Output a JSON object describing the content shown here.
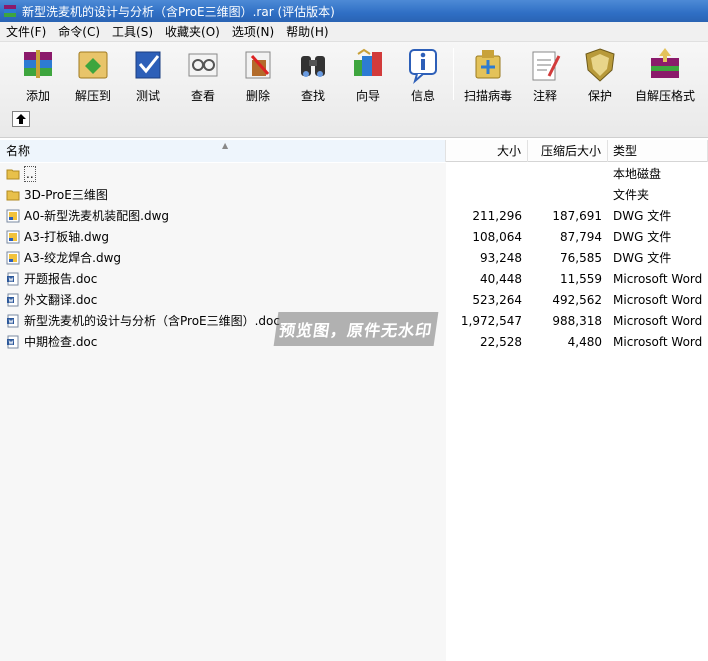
{
  "window": {
    "title": "新型洗麦机的设计与分析（含ProE三维图）.rar (评估版本)"
  },
  "menu": [
    "文件(F)",
    "命令(C)",
    "工具(S)",
    "收藏夹(O)",
    "选项(N)",
    "帮助(H)"
  ],
  "toolbar": {
    "buttons": [
      {
        "label": "添加",
        "icon": "add-archive-icon"
      },
      {
        "label": "解压到",
        "icon": "extract-to-icon"
      },
      {
        "label": "测试",
        "icon": "test-icon"
      },
      {
        "label": "查看",
        "icon": "view-icon"
      },
      {
        "label": "删除",
        "icon": "delete-icon"
      },
      {
        "label": "查找",
        "icon": "find-icon"
      },
      {
        "label": "向导",
        "icon": "wizard-icon"
      },
      {
        "label": "信息",
        "icon": "info-icon"
      },
      {
        "label": "扫描病毒",
        "icon": "virus-scan-icon"
      },
      {
        "label": "注释",
        "icon": "comment-icon"
      },
      {
        "label": "保护",
        "icon": "protect-icon"
      },
      {
        "label": "自解压格式",
        "icon": "sfx-icon"
      }
    ]
  },
  "columns": {
    "name": "名称",
    "size": "大小",
    "packed": "压缩后大小",
    "type": "类型"
  },
  "files": [
    {
      "name": "..",
      "size": "",
      "packed": "",
      "type": "本地磁盘",
      "icon": "folder-icon"
    },
    {
      "name": "3D-ProE三维图",
      "size": "",
      "packed": "",
      "type": "文件夹",
      "icon": "folder-icon"
    },
    {
      "name": "A0-新型洗麦机装配图.dwg",
      "size": "211,296",
      "packed": "187,691",
      "type": "DWG 文件",
      "icon": "dwg-icon"
    },
    {
      "name": "A3-打板轴.dwg",
      "size": "108,064",
      "packed": "87,794",
      "type": "DWG 文件",
      "icon": "dwg-icon"
    },
    {
      "name": "A3-绞龙焊合.dwg",
      "size": "93,248",
      "packed": "76,585",
      "type": "DWG 文件",
      "icon": "dwg-icon"
    },
    {
      "name": "开题报告.doc",
      "size": "40,448",
      "packed": "11,559",
      "type": "Microsoft Word",
      "icon": "doc-icon"
    },
    {
      "name": "外文翻译.doc",
      "size": "523,264",
      "packed": "492,562",
      "type": "Microsoft Word",
      "icon": "doc-icon"
    },
    {
      "name": "新型洗麦机的设计与分析（含ProE三维图）.doc",
      "size": "1,972,547",
      "packed": "988,318",
      "type": "Microsoft Word",
      "icon": "doc-icon"
    },
    {
      "name": "中期检查.doc",
      "size": "22,528",
      "packed": "4,480",
      "type": "Microsoft Word",
      "icon": "doc-icon"
    }
  ],
  "watermark": "预览图，原件无水印",
  "colors": {
    "titlebar": "#2f6fc4",
    "selection": "#eef5fc"
  }
}
